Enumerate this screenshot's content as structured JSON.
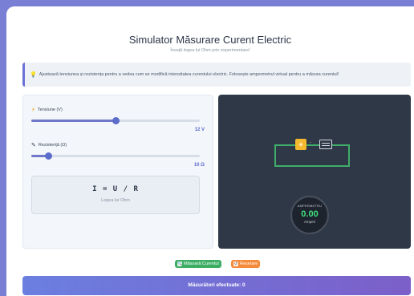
{
  "header": {
    "title": "Simulator Măsurare Curent Electric",
    "subtitle": "Învață legea lui Ohm prin experimentare!"
  },
  "info": {
    "icon": "lightbulb-icon",
    "text": "Ajustează tensiunea și rezistența pentru a vedea cum se modifică intensitatea curentului electric. Folosește ampermetrul virtual pentru a măsura curentul!"
  },
  "controls": {
    "voltage": {
      "label": "Tensiune (V)",
      "icon": "lightning-icon",
      "value_text": "12 V",
      "level": 0.5
    },
    "resistance": {
      "label": "Rezistență (Ω)",
      "icon": "resistor-icon",
      "value_text": "10 Ω",
      "level": 0.1
    },
    "formula": {
      "text": "I = U / R",
      "caption": "Legea lui Ohm"
    }
  },
  "simulation": {
    "battery_symbol": "+",
    "minus_symbol": "-",
    "ammeter": {
      "label": "AMPERMETRU",
      "value": "0.00",
      "unit": "Amperi"
    }
  },
  "actions": {
    "measure_label": "Măsoară Curentul",
    "reset_label": "Resetare"
  },
  "footer": {
    "measurements_text": "Măsurători efectuate: 0"
  },
  "colors": {
    "accent": "#5b6ccb",
    "measure": "#3cae63",
    "reset": "#f58a3a",
    "meter_value": "#3fdc7d"
  }
}
